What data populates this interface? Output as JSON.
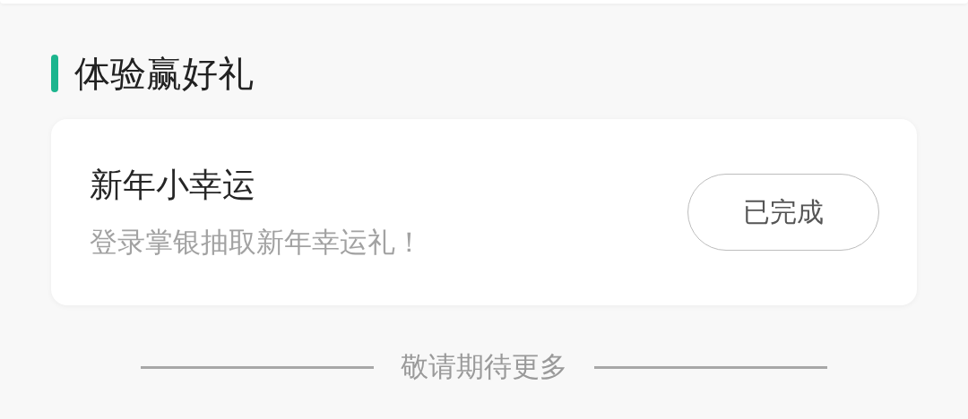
{
  "section": {
    "title": "体验赢好礼"
  },
  "tasks": [
    {
      "title": "新年小幸运",
      "subtitle": "登录掌银抽取新年幸运礼！",
      "action": "已完成",
      "disabled": true
    }
  ],
  "footer": {
    "text": "敬请期待更多"
  }
}
